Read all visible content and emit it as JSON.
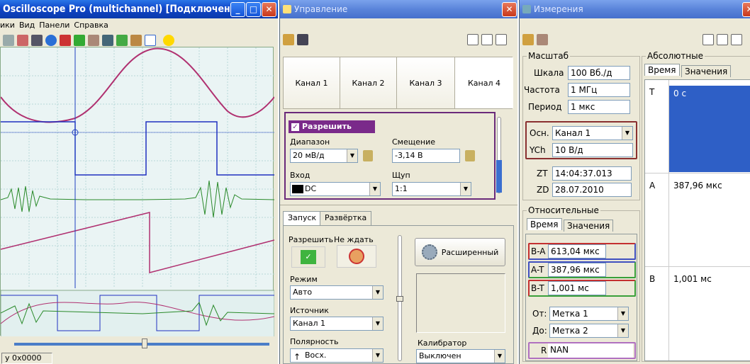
{
  "scope": {
    "title": "Oscilloscope Pro (multichannel) [Подключено ...",
    "menu": [
      "ики",
      "Вид",
      "Панели",
      "Справка"
    ],
    "status": "y 0x0000"
  },
  "control": {
    "title": "Управление",
    "channels": [
      "Канал 1",
      "Канал 2",
      "Канал 3",
      "Канал 4"
    ],
    "enable": "Разрешить",
    "range_label": "Диапазон",
    "range_value": "20 мВ/д",
    "offset_label": "Смещение",
    "offset_value": "-3,14 В",
    "input_label": "Вход",
    "input_value": "DC",
    "probe_label": "Щуп",
    "probe_value": "1:1",
    "tabs": [
      "Запуск",
      "Развёртка"
    ],
    "trig_enable": "Разрешить",
    "no_wait": "Не ждать",
    "advanced": "Расширенный",
    "mode_label": "Режим",
    "mode_value": "Авто",
    "source_label": "Источник",
    "source_value": "Канал 1",
    "polarity_label": "Полярность",
    "polarity_value": "Восх.",
    "calibrator_label": "Калибратор",
    "calibrator_value": "Выключен"
  },
  "measure": {
    "title": "Измерения",
    "scale_group": "Масштаб",
    "scale_label": "Шкала",
    "scale_value": "100 Вб./д",
    "freq_label": "Частота",
    "freq_value": "1 МГц",
    "period_label": "Период",
    "period_value": "1 мкс",
    "osn_label": "Осн.",
    "osn_value": "Канал 1",
    "ych_label": "YCh",
    "ych_value": "10 В/д",
    "zt_label": "ZT",
    "zt_value": "14:04:37.013",
    "zd_label": "ZD",
    "zd_value": "28.07.2010",
    "rel_group": "Относительные",
    "rel_tabs": [
      "Время",
      "Значения"
    ],
    "ba_label": "B-A",
    "ba_value": "613,04 мкс",
    "at_label": "A-T",
    "at_value": "387,96 мкс",
    "bt_label": "B-T",
    "bt_value": "1,001 мс",
    "from_label": "От:",
    "from_value": "Метка 1",
    "to_label": "До:",
    "to_value": "Метка 2",
    "r_label": "R",
    "r_value": "NAN",
    "abs_group": "Абсолютные",
    "abs_tabs": [
      "Время",
      "Значения"
    ],
    "abs_rows": [
      {
        "label": "T",
        "value": "0 с"
      },
      {
        "label": "A",
        "value": "387,96 мкс"
      },
      {
        "label": "B",
        "value": "1,001 мс"
      }
    ]
  }
}
